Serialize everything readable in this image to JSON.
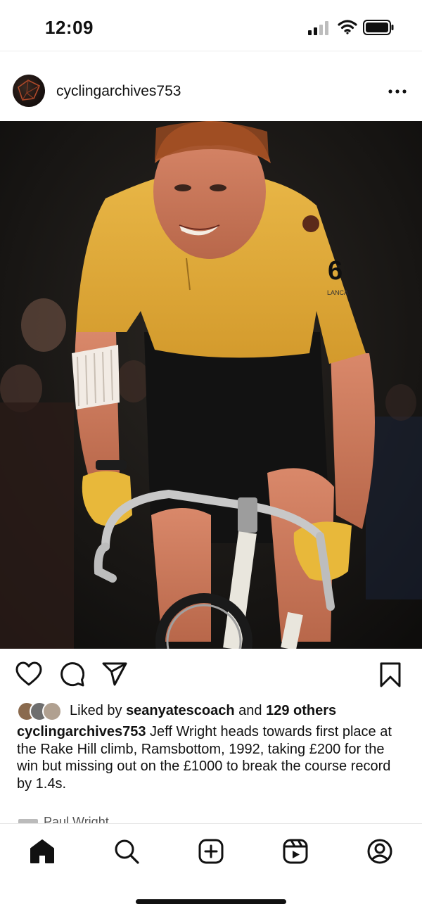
{
  "status_bar": {
    "time": "12:09"
  },
  "post": {
    "username": "cyclingarchives753",
    "likes": {
      "prefix": "Liked by",
      "liker": "seanyatescoach",
      "joiner": "and",
      "others": "129 others"
    },
    "caption": {
      "username": "cyclingarchives753",
      "text": "Jeff Wright heads towards first place at the Rake Hill climb, Ramsbottom, 1992, taking £200 for the win but missing out on the £1000 to break the course record by 1.4s."
    },
    "comment_preview_name": "Paul Wright",
    "jersey_number": "6",
    "jersey_sponsor": "LANCA"
  },
  "icons": {
    "header": [
      "more-icon"
    ],
    "actions": [
      "like-icon",
      "comment-icon",
      "share-icon",
      "save-icon"
    ],
    "bottom_nav": [
      "home-icon",
      "search-icon",
      "create-icon",
      "reels-icon",
      "profile-icon"
    ]
  },
  "colors": {
    "text": "#111111",
    "jersey_yellow": "#e2ae3a",
    "background": "#ffffff"
  }
}
